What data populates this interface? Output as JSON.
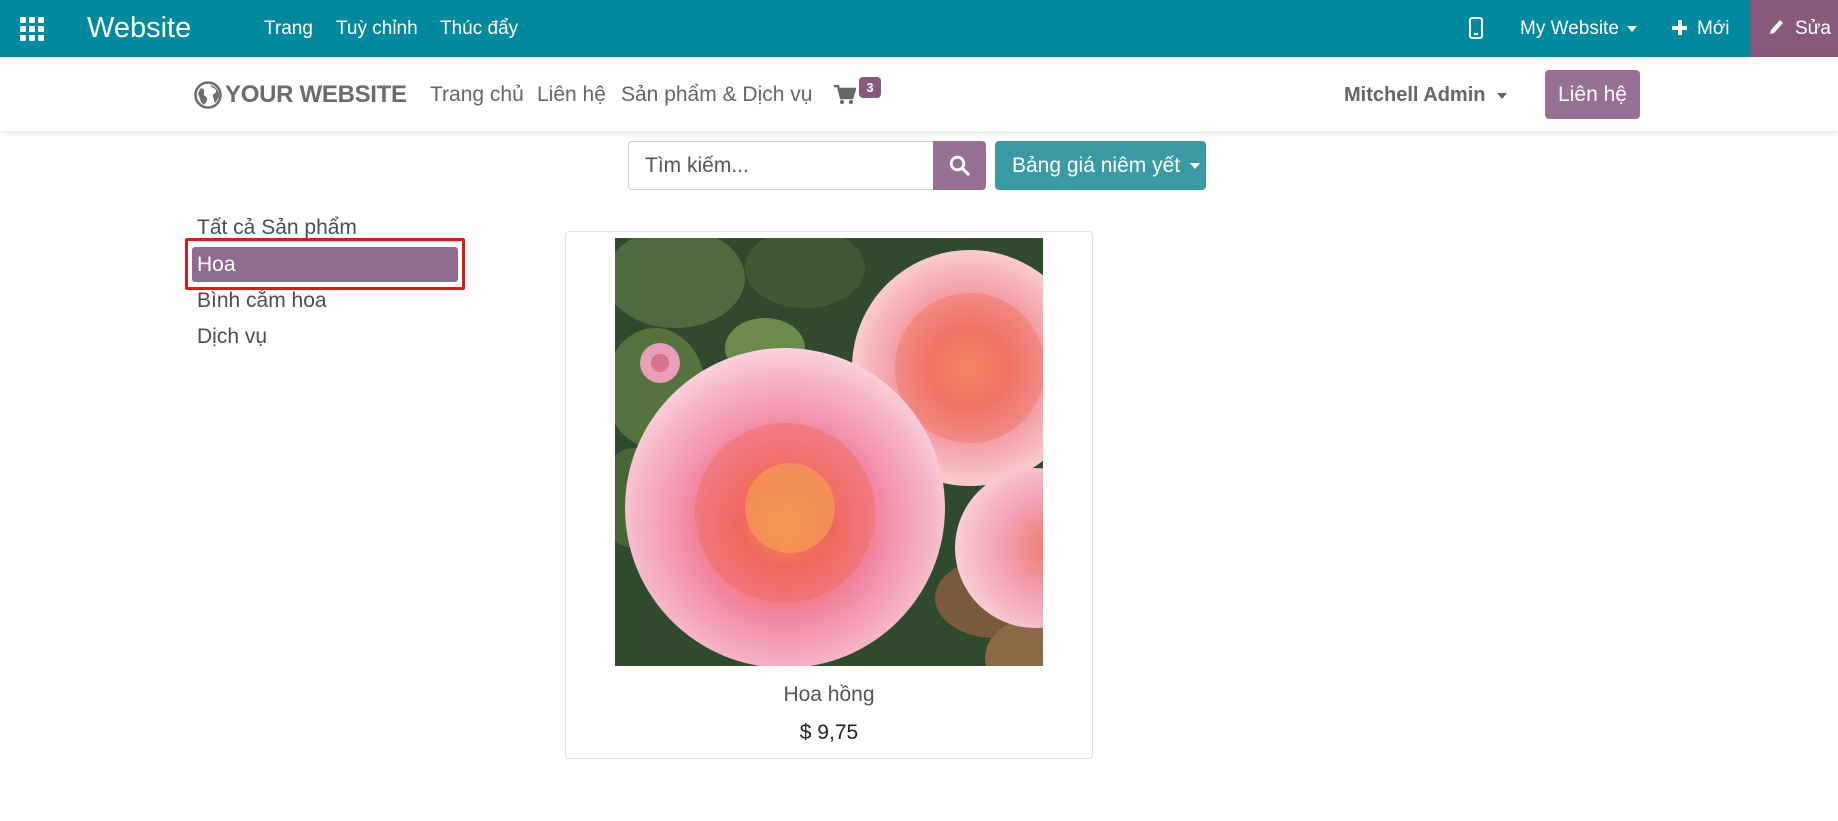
{
  "topbar": {
    "app_title": "Website",
    "menu": [
      "Trang",
      "Tuỳ chỉnh",
      "Thúc đẩy"
    ],
    "website_selector": "My Website",
    "new_label": "Mới",
    "edit_label": "Sửa",
    "bg_color": "#018a9d",
    "edit_color": "#875a7b"
  },
  "header": {
    "logo_text": "YOUR WEBSITE",
    "nav": [
      "Trang chủ",
      "Liên hệ",
      "Sản phẩm & Dịch vụ"
    ],
    "cart_count": "3",
    "user_name": "Mitchell Admin",
    "contact_button": "Liên hệ"
  },
  "search": {
    "placeholder": "Tìm kiếm...",
    "pricelist_label": "Bảng giá niêm yết"
  },
  "categories": {
    "items": [
      "Tất cả Sản phẩm",
      "Hoa",
      "Bình cắm hoa",
      "Dịch vụ"
    ],
    "active_index": 1
  },
  "products": [
    {
      "name": "Hoa hồng",
      "price": "$ 9,75",
      "image": "pink-rose-photo"
    }
  ]
}
